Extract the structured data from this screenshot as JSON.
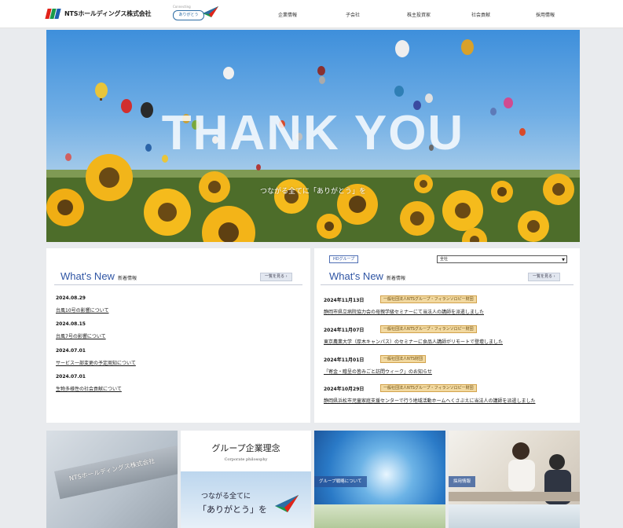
{
  "header": {
    "company_name": "NTSホールディングス株式会社",
    "badge_top": "Connecting",
    "badge_label": "ありがとう",
    "nav": [
      "企業情報",
      "子会社",
      "株主投資家",
      "社会貢献",
      "採用情報"
    ]
  },
  "hero": {
    "title": "THANK YOU",
    "subtitle": "つながる全てに「ありがとう」を"
  },
  "news_left": {
    "title": "What's New",
    "subtitle": "新着情報",
    "more": "一覧を見る ›",
    "items": [
      {
        "date": "2024.08.29",
        "text": "台風10号の影響について"
      },
      {
        "date": "2024.08.15",
        "text": "台風7号の影響について"
      },
      {
        "date": "2024.07.01",
        "text": "サービス一部変更の予定周知について"
      },
      {
        "date": "2024.07.01",
        "text": "生物多様性の社会貢献について"
      }
    ]
  },
  "news_right": {
    "group_tag": "HDグループ",
    "select_value": "全社",
    "title": "What's New",
    "subtitle": "新着情報",
    "more": "一覧を見る ›",
    "items": [
      {
        "date": "2024年11月13日",
        "tag": "一般社団法人NTSグループ・フィランソロピー財団",
        "text": "静岡市県立病院協力会の母親学級セミナーにて当法人の講師を派遣しました"
      },
      {
        "date": "2024年11月07日",
        "tag": "一般社団法人NTSグループ・フィランソロピー財団",
        "text": "東京農業大学（厚木キャンパス）のセミナーに食品人講師がリモートで登壇しました"
      },
      {
        "date": "2024年11月01日",
        "tag": "一般社団法人NTS財団",
        "text": "「寄金・贈呈の皆みごと訪問ウィーク」のお知らせ"
      },
      {
        "date": "2024年10月29日",
        "tag": "一般社団法人NTSグループ・フィランソロピー財団",
        "text": "静岡県浜松市児童家庭支援センターで行う地域活動ホームへくさぶえに当法人の講師を派遣しました"
      }
    ]
  },
  "tiles": {
    "building_sign": "NTSホールディングス株式会社",
    "philosophy_title": "グループ企業理念",
    "philosophy_sub": "Corporate philosophy",
    "philosophy_line1": "つながる全てに",
    "philosophy_line2": "「ありがとう」を",
    "strategy_label": "グループ戦略について",
    "recruit_label": "採用情報"
  }
}
